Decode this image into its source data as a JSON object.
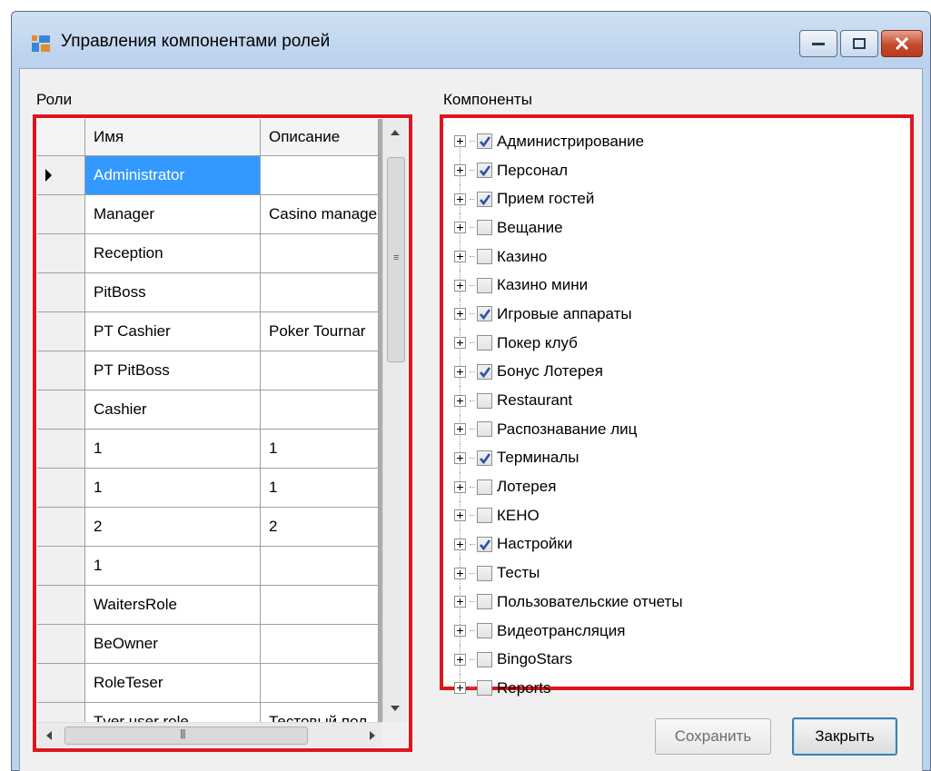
{
  "window": {
    "title": "Управления компонентами ролей"
  },
  "roles": {
    "label": "Роли",
    "columns": [
      "Имя",
      "Описание"
    ],
    "rows": [
      {
        "name": "Administrator",
        "desc": ""
      },
      {
        "name": "Manager",
        "desc": "Casino manage"
      },
      {
        "name": "Reception",
        "desc": ""
      },
      {
        "name": "PitBoss",
        "desc": ""
      },
      {
        "name": "PT Cashier",
        "desc": "Poker Tournar"
      },
      {
        "name": "PT PitBoss",
        "desc": ""
      },
      {
        "name": "Cashier",
        "desc": ""
      },
      {
        "name": "1",
        "desc": "1"
      },
      {
        "name": "1",
        "desc": "1"
      },
      {
        "name": "2",
        "desc": "2"
      },
      {
        "name": "1",
        "desc": ""
      },
      {
        "name": "WaitersRole",
        "desc": ""
      },
      {
        "name": "BeOwner",
        "desc": ""
      },
      {
        "name": "RoleTeser",
        "desc": ""
      },
      {
        "name": "Tver user role",
        "desc": "Тестовый пол"
      }
    ],
    "selected_index": 0
  },
  "components": {
    "label": "Компоненты",
    "items": [
      {
        "label": "Администрирование",
        "checked": true
      },
      {
        "label": "Персонал",
        "checked": true
      },
      {
        "label": "Прием гостей",
        "checked": true
      },
      {
        "label": "Вещание",
        "checked": false
      },
      {
        "label": "Казино",
        "checked": false
      },
      {
        "label": "Казино мини",
        "checked": false
      },
      {
        "label": "Игровые аппараты",
        "checked": true
      },
      {
        "label": "Покер клуб",
        "checked": false
      },
      {
        "label": "Бонус Лотерея",
        "checked": true
      },
      {
        "label": "Restaurant",
        "checked": false
      },
      {
        "label": "Распознавание лиц",
        "checked": false
      },
      {
        "label": "Терминалы",
        "checked": true
      },
      {
        "label": "Лотерея",
        "checked": false
      },
      {
        "label": "КЕНО",
        "checked": false
      },
      {
        "label": "Настройки",
        "checked": true
      },
      {
        "label": "Тесты",
        "checked": false
      },
      {
        "label": "Пользовательские отчеты",
        "checked": false
      },
      {
        "label": "Видеотрансляция",
        "checked": false
      },
      {
        "label": "BingoStars",
        "checked": false
      },
      {
        "label": "Reports",
        "checked": false
      }
    ]
  },
  "buttons": {
    "save": "Сохранить",
    "close": "Закрыть"
  },
  "colors": {
    "highlight_border": "#e1141e",
    "selection": "#3399ff",
    "check": "#2b52a8"
  }
}
